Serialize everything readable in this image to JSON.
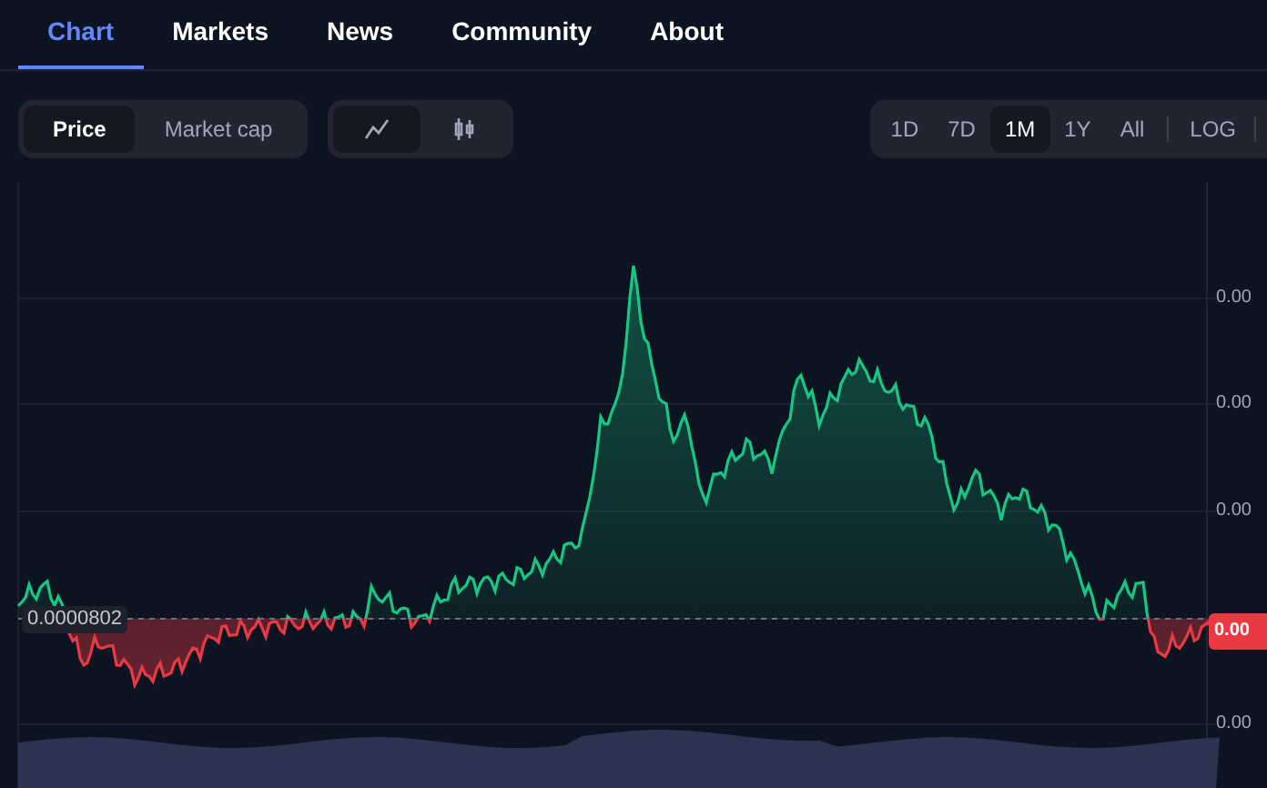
{
  "tabs": [
    {
      "label": "Chart",
      "selected": true
    },
    {
      "label": "Markets",
      "selected": false
    },
    {
      "label": "News",
      "selected": false
    },
    {
      "label": "Community",
      "selected": false
    },
    {
      "label": "About",
      "selected": false
    }
  ],
  "metric_toggle": [
    {
      "label": "Price",
      "selected": true
    },
    {
      "label": "Market cap",
      "selected": false
    }
  ],
  "chart_type_toggle": [
    {
      "kind": "line",
      "selected": true
    },
    {
      "kind": "candles",
      "selected": false
    }
  ],
  "ranges": [
    {
      "label": "1D",
      "selected": false
    },
    {
      "label": "7D",
      "selected": false
    },
    {
      "label": "1M",
      "selected": true
    },
    {
      "label": "1Y",
      "selected": false
    },
    {
      "label": "All",
      "selected": false
    }
  ],
  "log_button": {
    "label": "LOG"
  },
  "chart": {
    "y_axis_labels": [
      "0.00",
      "0.00",
      "0.00",
      "0.00"
    ],
    "current_price_badge": "0.00",
    "baseline_label": "0.0000802"
  }
}
